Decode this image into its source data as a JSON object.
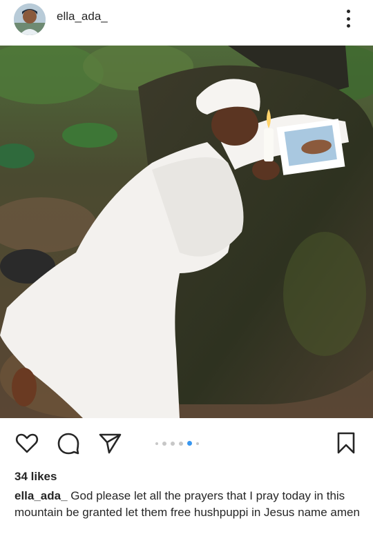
{
  "post": {
    "username": "ella_ada_",
    "likes": "34 likes",
    "caption_user": "ella_ada_",
    "caption_text": " God please let all the prayers that I pray today in this mountain be granted let them free  hushpuppi in Jesus name amen"
  },
  "carousel": {
    "total": 6,
    "active_index": 4
  },
  "icons": {
    "more": "more-vertical-icon",
    "like": "heart-icon",
    "comment": "comment-icon",
    "share": "send-icon",
    "save": "bookmark-icon"
  },
  "colors": {
    "accent": "#3897f0",
    "text": "#262626",
    "dot_inactive": "#c7c7c7"
  }
}
